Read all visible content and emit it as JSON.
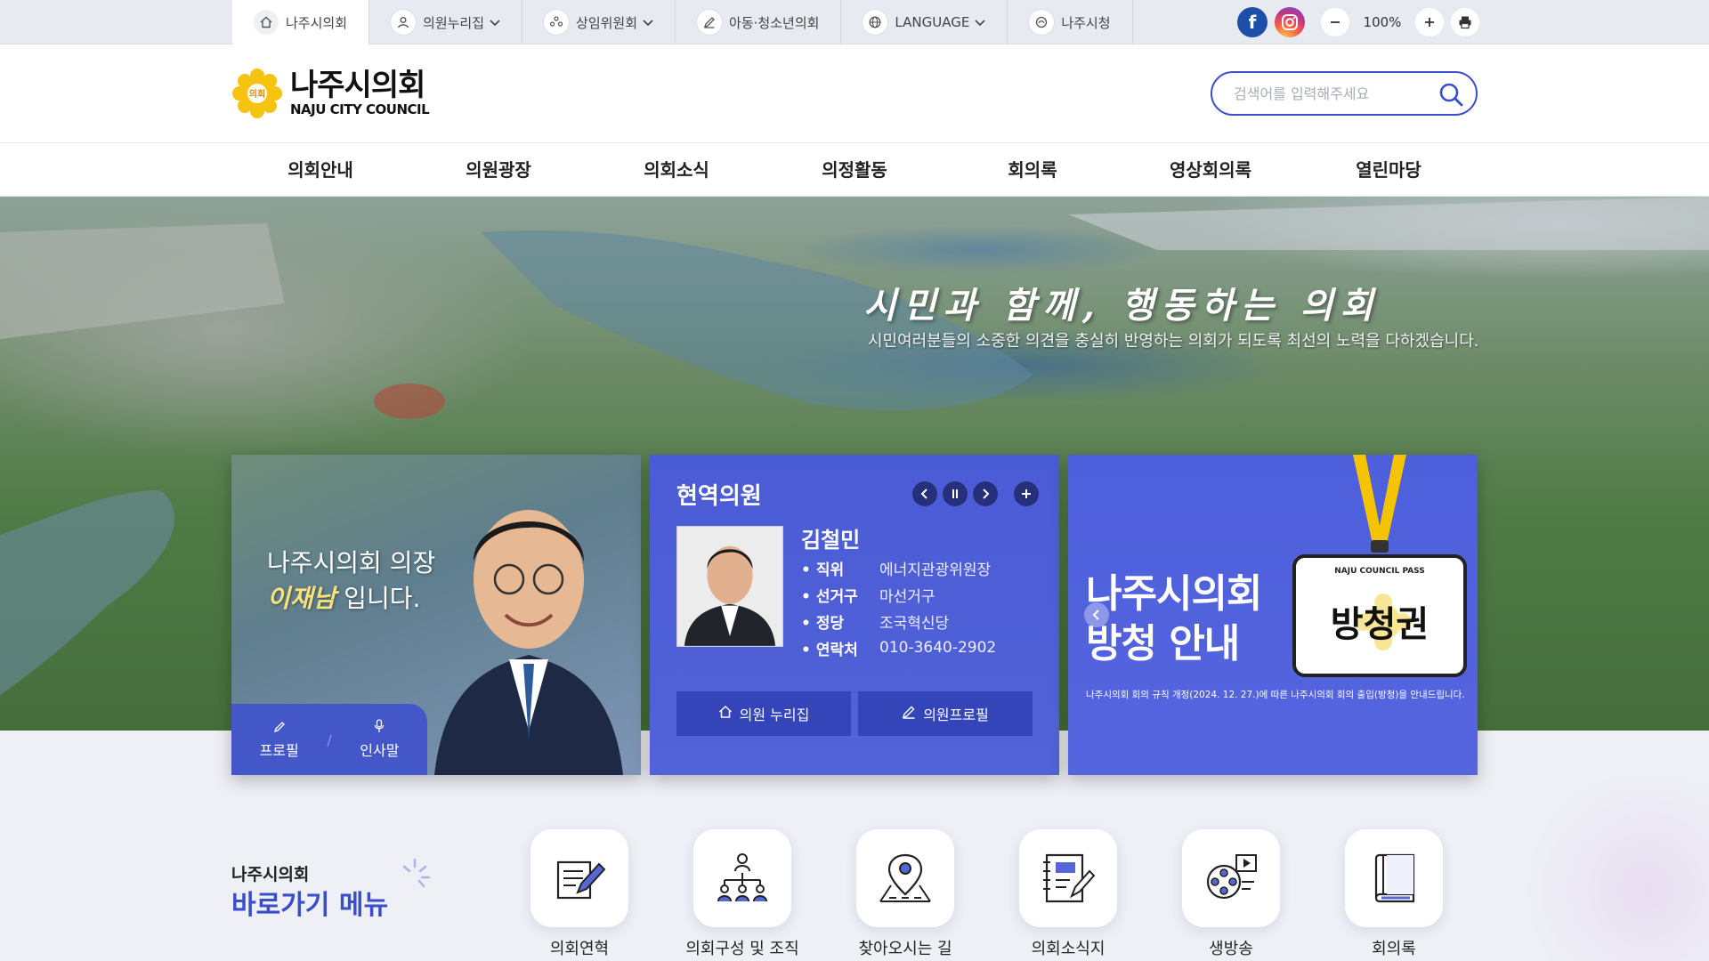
{
  "topbar": {
    "tabs": [
      {
        "label": "나주시의회",
        "icon": "home-icon",
        "dropdown": false
      },
      {
        "label": "의원누리집",
        "icon": "person-icon",
        "dropdown": true
      },
      {
        "label": "상임위원회",
        "icon": "group-icon",
        "dropdown": true
      },
      {
        "label": "아동·청소년의회",
        "icon": "pencil-icon",
        "dropdown": false
      },
      {
        "label": "LANGUAGE",
        "icon": "globe-icon",
        "dropdown": true
      },
      {
        "label": "나주시청",
        "icon": "cityhall-icon",
        "dropdown": false
      }
    ],
    "zoom": "100%",
    "facebook_icon": "facebook-icon",
    "instagram_icon": "instagram-icon"
  },
  "header": {
    "logo_ko": "나주시의회",
    "logo_en": "NAJU CITY COUNCIL",
    "logo_emblem_text": "의회",
    "search_placeholder": "검색어를 입력해주세요"
  },
  "gnb": [
    "의회안내",
    "의원광장",
    "의회소식",
    "의정활동",
    "회의록",
    "영상회의록",
    "열린마당"
  ],
  "hero": {
    "title": "시민과 함께, 행동하는 의회",
    "subtitle": "시민여러분들의 소중한 의견을 충실히 반영하는 의회가 되도록 최선의 노력을 다하겠습니다."
  },
  "chair_card": {
    "line1": "나주시의회 의장",
    "name": "이재남",
    "line2_suffix": " 입니다.",
    "btn_profile": "프로필",
    "btn_greeting": "인사말"
  },
  "member_card": {
    "title": "현역의원",
    "name": "김철민",
    "rows": [
      {
        "k": "직위",
        "v": "에너지관광위원장"
      },
      {
        "k": "선거구",
        "v": "마선거구"
      },
      {
        "k": "정당",
        "v": "조국혁신당"
      },
      {
        "k": "연락처",
        "v": "010-3640-2902"
      }
    ],
    "btn_home": "의원 누리집",
    "btn_profile": "의원프로필"
  },
  "pass_card": {
    "title1": "나주시의회",
    "title2": "방청 안내",
    "badge_top": "NAJU COUNCIL PASS",
    "badge_text": "방청권",
    "note": "나주시의회 회의 규칙 개정(2024. 12. 27.)에 따른 나주시의회 회의 출입(방청)을 안내드립니다."
  },
  "quick": {
    "label_small": "나주시의회",
    "label_big": "바로가기 메뉴",
    "items": [
      {
        "label": "의회연혁",
        "icon": "history-icon"
      },
      {
        "label": "의회구성 및 조직",
        "icon": "organization-icon"
      },
      {
        "label": "찾아오시는 길",
        "icon": "location-pin-icon"
      },
      {
        "label": "의회소식지",
        "icon": "newsletter-icon"
      },
      {
        "label": "생방송",
        "icon": "live-broadcast-icon"
      },
      {
        "label": "회의록",
        "icon": "minutes-book-icon"
      }
    ]
  },
  "colors": {
    "primary": "#3a4ec9",
    "card_blue": "#4a5bd6",
    "badge_yellow": "#f5c400"
  }
}
